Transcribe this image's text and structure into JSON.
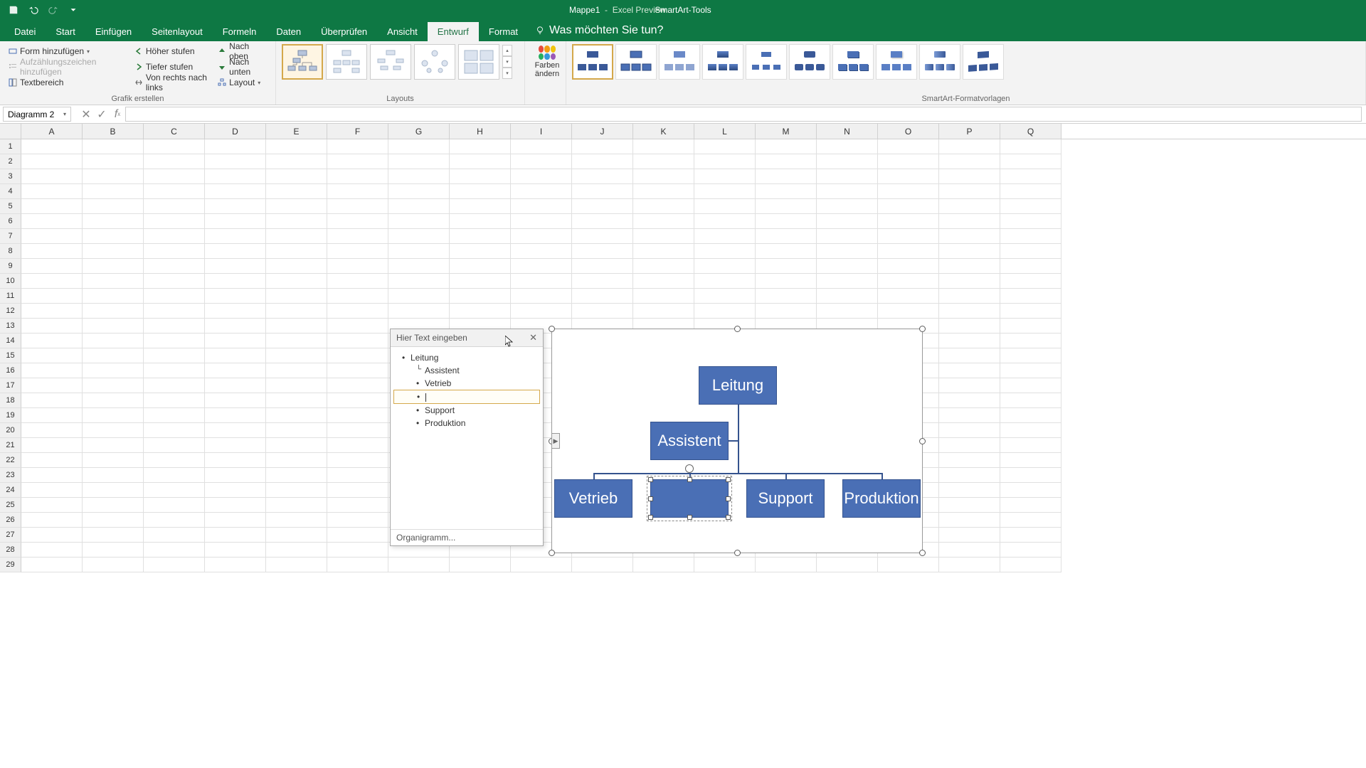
{
  "title": {
    "tool_tab": "SmartArt-Tools",
    "workbook": "Mappe1",
    "app": "Excel Preview"
  },
  "tabs": [
    "Datei",
    "Start",
    "Einfügen",
    "Seitenlayout",
    "Formeln",
    "Daten",
    "Überprüfen",
    "Ansicht",
    "Entwurf",
    "Format"
  ],
  "active_tab": "Entwurf",
  "tell_me": "Was möchten Sie tun?",
  "ribbon": {
    "create": {
      "add_shape": "Form hinzufügen",
      "add_bullet": "Aufzählungszeichen hinzufügen",
      "text_pane": "Textbereich",
      "promote": "Höher stufen",
      "demote": "Tiefer stufen",
      "rtl": "Von rechts nach links",
      "move_up": "Nach oben",
      "move_down": "Nach unten",
      "layout_menu": "Layout",
      "group_label": "Grafik erstellen"
    },
    "layouts_label": "Layouts",
    "colors_label": "Farben\nändern",
    "styles_label": "SmartArt-Formatvorlagen"
  },
  "name_box": "Diagramm 2",
  "columns": [
    "A",
    "B",
    "C",
    "D",
    "E",
    "F",
    "G",
    "H",
    "I",
    "J",
    "K",
    "L",
    "M",
    "N",
    "O",
    "P",
    "Q"
  ],
  "rows": 29,
  "text_pane": {
    "title": "Hier Text eingeben",
    "items": [
      {
        "text": "Leitung",
        "level": 1
      },
      {
        "text": "Assistent",
        "level": 2,
        "assist": true
      },
      {
        "text": "Vetrieb",
        "level": 2
      },
      {
        "text": "",
        "level": 2,
        "editing": true
      },
      {
        "text": "Support",
        "level": 2
      },
      {
        "text": "Produktion",
        "level": 2
      }
    ],
    "footer": "Organigramm..."
  },
  "org_nodes": {
    "leitung": "Leitung",
    "assistent": "Assistent",
    "vetrieb": "Vetrieb",
    "empty": "",
    "support": "Support",
    "produktion": "Produktion"
  }
}
